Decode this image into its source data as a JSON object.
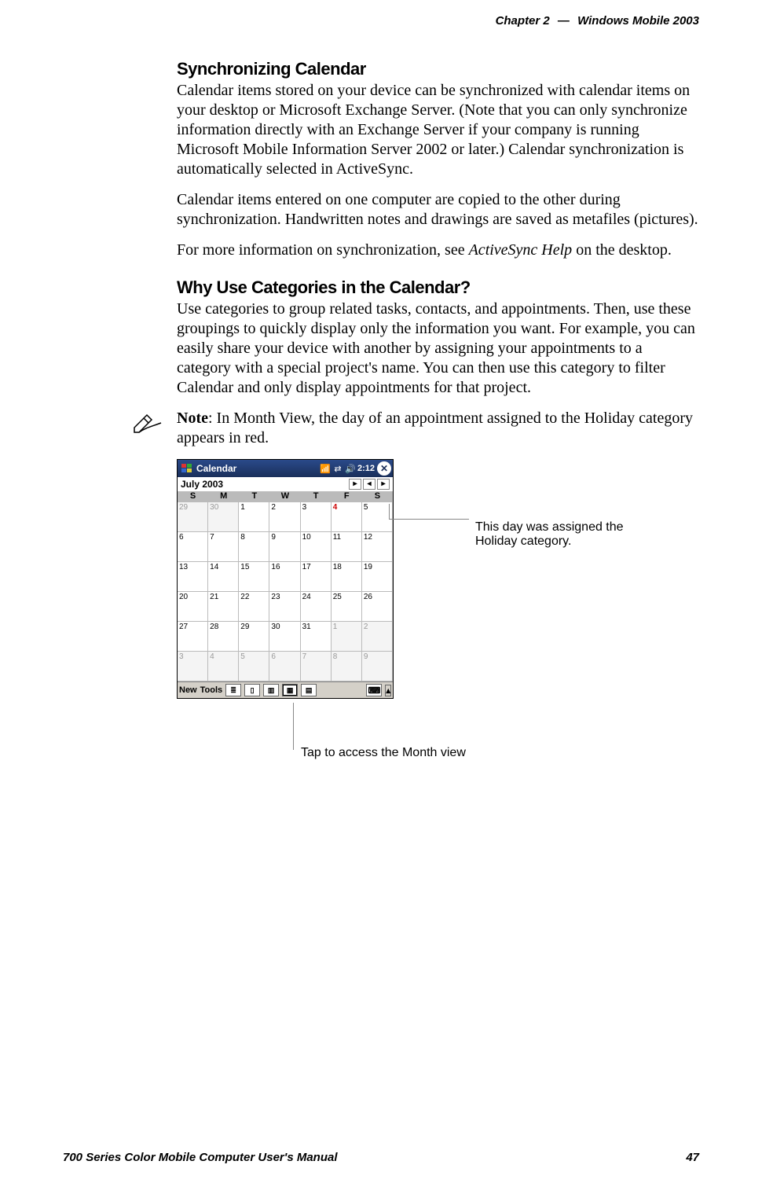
{
  "header": {
    "chapter": "Chapter 2",
    "dash": "—",
    "title": "Windows Mobile 2003"
  },
  "section1": {
    "heading": "Synchronizing Calendar",
    "p1": "Calendar items stored on your device can be synchronized with calendar items on your desktop or Microsoft Exchange Server. (Note that you can only synchronize information directly with an Exchange Server if your company is running Microsoft Mobile Information Server 2002 or later.) Calendar synchronization is automatically selected in ActiveSync.",
    "p2": "Calendar items entered on one computer are copied to the other during synchronization. Handwritten notes and drawings are saved as metafiles (pictures).",
    "p3_pre": "For more information on synchronization, see ",
    "p3_em": "ActiveSync Help",
    "p3_post": " on the desktop."
  },
  "section2": {
    "heading": "Why Use Categories in the Calendar?",
    "p1": "Use categories to group related tasks, contacts, and appointments. Then, use these groupings to quickly display only the information you want. For example, you can easily share your device with another by assigning your appointments to a category with a special project's name. You can then use this category to filter Calendar and only display appointments for that project.",
    "note_label": "Note",
    "note_text": ": In Month View, the day of an appointment assigned to the Holiday category appears in red."
  },
  "screenshot": {
    "app_title": "Calendar",
    "time": "2:12",
    "close_label": "✕",
    "month_label": "July 2003",
    "days_of_week": [
      "S",
      "M",
      "T",
      "W",
      "T",
      "F",
      "S"
    ],
    "weeks": [
      [
        {
          "n": "29",
          "other": true
        },
        {
          "n": "30",
          "other": true
        },
        {
          "n": "1"
        },
        {
          "n": "2"
        },
        {
          "n": "3"
        },
        {
          "n": "4",
          "holiday": true
        },
        {
          "n": "5"
        }
      ],
      [
        {
          "n": "6"
        },
        {
          "n": "7"
        },
        {
          "n": "8"
        },
        {
          "n": "9"
        },
        {
          "n": "10"
        },
        {
          "n": "11"
        },
        {
          "n": "12"
        }
      ],
      [
        {
          "n": "13"
        },
        {
          "n": "14"
        },
        {
          "n": "15"
        },
        {
          "n": "16"
        },
        {
          "n": "17"
        },
        {
          "n": "18"
        },
        {
          "n": "19"
        }
      ],
      [
        {
          "n": "20"
        },
        {
          "n": "21"
        },
        {
          "n": "22"
        },
        {
          "n": "23"
        },
        {
          "n": "24"
        },
        {
          "n": "25"
        },
        {
          "n": "26"
        }
      ],
      [
        {
          "n": "27"
        },
        {
          "n": "28"
        },
        {
          "n": "29"
        },
        {
          "n": "30"
        },
        {
          "n": "31"
        },
        {
          "n": "1",
          "other": true
        },
        {
          "n": "2",
          "other": true
        }
      ],
      [
        {
          "n": "3",
          "other": true
        },
        {
          "n": "4",
          "other": true
        },
        {
          "n": "5",
          "other": true
        },
        {
          "n": "6",
          "other": true
        },
        {
          "n": "7",
          "other": true
        },
        {
          "n": "8",
          "other": true
        },
        {
          "n": "9",
          "other": true
        }
      ]
    ],
    "menu_new": "New",
    "menu_tools": "Tools"
  },
  "callouts": {
    "right": "This day was assigned the Holiday category.",
    "below": "Tap to access the Month view"
  },
  "footer": {
    "left": "700 Series Color Mobile Computer User's Manual",
    "pagenum": "47"
  }
}
